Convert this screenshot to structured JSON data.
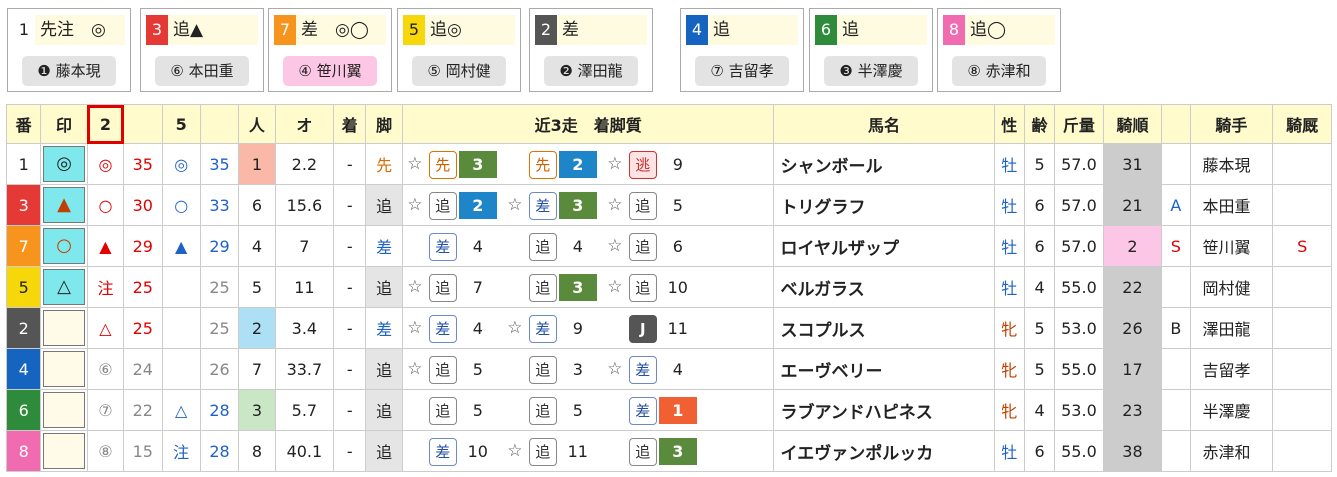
{
  "cards": [
    {
      "num": "1",
      "mark": "先注　◎",
      "jockey": "❶ 藤本現",
      "cls": "c-wk1",
      "pink": false
    },
    {
      "num": "3",
      "mark": "追▲",
      "jockey": "⑥ 本田重",
      "cls": "c-wk3",
      "pink": false
    },
    {
      "num": "7",
      "mark": "差　◎◯",
      "jockey": "④ 笹川翼",
      "cls": "c-wk7",
      "pink": true
    },
    {
      "num": "5",
      "mark": "追◎",
      "jockey": "⑤ 岡村健",
      "cls": "c-wk5",
      "pink": false
    },
    {
      "num": "2",
      "mark": "差",
      "jockey": "❷ 澤田龍",
      "cls": "c-wk2",
      "pink": false
    },
    {
      "num": "4",
      "mark": "追",
      "jockey": "⑦ 吉留孝",
      "cls": "c-wk4",
      "pink": false
    },
    {
      "num": "6",
      "mark": "追",
      "jockey": "❸ 半澤慶",
      "cls": "c-wk6",
      "pink": false
    },
    {
      "num": "8",
      "mark": "追◯",
      "jockey": "⑧ 赤津和",
      "cls": "c-wk8",
      "pink": false
    }
  ],
  "headers": {
    "ban": "番",
    "shirushi": "印",
    "col2": "2",
    "col5": "5",
    "ninki": "人",
    "odds": "オ",
    "chaku": "着",
    "ashi": "脚",
    "recent": "近3走　着脚質",
    "name": "馬名",
    "sex": "性",
    "age": "齢",
    "weight": "斤量",
    "kijun": "騎順",
    "jockey": "騎手",
    "kyusha": "騎厩"
  },
  "rows": [
    {
      "ban": "1",
      "wk": "c-wk1",
      "mark": "◎",
      "markCls": "mk-cyan",
      "m2": "◎",
      "m2c": "red",
      "v2": "35",
      "v2c": "red",
      "m5": "◎",
      "m5c": "blue",
      "v5": "35",
      "v5c": "blue",
      "ninki": "1",
      "nbg": "bgpink",
      "odds": "2.2",
      "chaku": "-",
      "ashi": "先",
      "ashiC": "orange",
      "ashiBg": "",
      "races": [
        {
          "st": "☆",
          "pos": "先",
          "pc": "p-lead",
          "fin": "3",
          "fc": "f-g"
        },
        {
          "st": "",
          "pos": "先",
          "pc": "p-lead",
          "fin": "2",
          "fc": "f-b"
        },
        {
          "st": "☆",
          "pos": "逃",
          "pc": "p-esc",
          "fin": "9",
          "fc": "f-n"
        }
      ],
      "name": "シャンボール",
      "sex": "牡",
      "sexC": "sexm",
      "age": "5",
      "weight": "57.0",
      "kijun": "31",
      "kbg": "kijun",
      "s1": "",
      "jockey": "藤本現",
      "s2": ""
    },
    {
      "ban": "3",
      "wk": "c-wk3",
      "mark": "▲",
      "markCls": "mk-cyan",
      "markC": "brown",
      "m2": "○",
      "m2c": "red",
      "v2": "30",
      "v2c": "red",
      "m5": "○",
      "m5c": "blue",
      "v5": "33",
      "v5c": "blue",
      "ninki": "6",
      "nbg": "",
      "odds": "15.6",
      "chaku": "-",
      "ashi": "追",
      "ashiC": "",
      "ashiBg": "bggrey",
      "races": [
        {
          "st": "☆",
          "pos": "追",
          "pc": "p-oi",
          "fin": "2",
          "fc": "f-b"
        },
        {
          "st": "☆",
          "pos": "差",
          "pc": "p-sashi",
          "fin": "3",
          "fc": "f-g"
        },
        {
          "st": "☆",
          "pos": "追",
          "pc": "p-oi",
          "fin": "5",
          "fc": "f-n"
        }
      ],
      "name": "トリグラフ",
      "sex": "牡",
      "sexC": "sexm",
      "age": "6",
      "weight": "57.0",
      "kijun": "21",
      "kbg": "kijun",
      "s1": "A",
      "s1c": "blue",
      "jockey": "本田重",
      "s2": ""
    },
    {
      "ban": "7",
      "wk": "c-wk7",
      "mark": "○",
      "markCls": "mk-cyan",
      "markC": "brown",
      "m2": "▲",
      "m2c": "red",
      "v2": "29",
      "v2c": "red",
      "m5": "▲",
      "m5c": "blue",
      "v5": "29",
      "v5c": "blue",
      "ninki": "4",
      "nbg": "",
      "odds": "7",
      "chaku": "-",
      "ashi": "差",
      "ashiC": "blue",
      "ashiBg": "",
      "races": [
        {
          "st": "",
          "pos": "差",
          "pc": "p-sashi",
          "fin": "4",
          "fc": "f-n"
        },
        {
          "st": "",
          "pos": "追",
          "pc": "p-oi",
          "fin": "4",
          "fc": "f-n"
        },
        {
          "st": "☆",
          "pos": "追",
          "pc": "p-oi",
          "fin": "6",
          "fc": "f-n"
        }
      ],
      "name": "ロイヤルザップ",
      "sex": "牡",
      "sexC": "sexm",
      "age": "6",
      "weight": "57.0",
      "kijun": "2",
      "kbg": "bgpink2",
      "s1": "S",
      "s1c": "red",
      "jockey": "笹川翼",
      "s2": "S"
    },
    {
      "ban": "5",
      "wk": "c-wk5",
      "mark": "△",
      "markCls": "mk-cyan",
      "m2": "注",
      "m2c": "red",
      "v2": "25",
      "v2c": "red",
      "m5": "",
      "m5c": "",
      "v5": "25",
      "v5c": "grey",
      "ninki": "5",
      "nbg": "",
      "odds": "11",
      "chaku": "-",
      "ashi": "追",
      "ashiC": "",
      "ashiBg": "bggrey",
      "races": [
        {
          "st": "☆",
          "pos": "追",
          "pc": "p-oi",
          "fin": "7",
          "fc": "f-n"
        },
        {
          "st": "",
          "pos": "追",
          "pc": "p-oi",
          "fin": "3",
          "fc": "f-g"
        },
        {
          "st": "☆",
          "pos": "追",
          "pc": "p-oi",
          "fin": "10",
          "fc": "f-n"
        }
      ],
      "name": "ベルガラス",
      "sex": "牡",
      "sexC": "sexm",
      "age": "4",
      "weight": "55.0",
      "kijun": "22",
      "kbg": "kijun",
      "s1": "",
      "jockey": "岡村健",
      "s2": ""
    },
    {
      "ban": "2",
      "wk": "c-wk2",
      "mark": "",
      "markCls": "mk-empty",
      "m2": "△",
      "m2c": "red",
      "v2": "25",
      "v2c": "red",
      "m5": "",
      "m5c": "",
      "v5": "25",
      "v5c": "grey",
      "ninki": "2",
      "nbg": "bglightblue",
      "odds": "3.4",
      "chaku": "-",
      "ashi": "差",
      "ashiC": "blue",
      "ashiBg": "",
      "races": [
        {
          "st": "☆",
          "pos": "差",
          "pc": "p-sashi",
          "fin": "4",
          "fc": "f-n"
        },
        {
          "st": "☆",
          "pos": "差",
          "pc": "p-sashi",
          "fin": "9",
          "fc": "f-n"
        },
        {
          "st": "",
          "pos": "J",
          "pc": "p-j",
          "fin": "11",
          "fc": "f-n"
        }
      ],
      "name": "スコプルス",
      "sex": "牝",
      "sexC": "sexf",
      "age": "5",
      "weight": "53.0",
      "kijun": "26",
      "kbg": "kijun",
      "s1": "B",
      "s1c": "",
      "jockey": "澤田龍",
      "s2": ""
    },
    {
      "ban": "4",
      "wk": "c-wk4",
      "mark": "",
      "markCls": "mk-empty",
      "m2": "⑥",
      "m2c": "grey",
      "v2": "24",
      "v2c": "grey",
      "m5": "",
      "m5c": "",
      "v5": "26",
      "v5c": "grey",
      "ninki": "7",
      "nbg": "",
      "odds": "33.7",
      "chaku": "-",
      "ashi": "追",
      "ashiC": "",
      "ashiBg": "bggrey",
      "races": [
        {
          "st": "☆",
          "pos": "追",
          "pc": "p-oi",
          "fin": "5",
          "fc": "f-n"
        },
        {
          "st": "",
          "pos": "追",
          "pc": "p-oi",
          "fin": "3",
          "fc": "f-n"
        },
        {
          "st": "☆",
          "pos": "差",
          "pc": "p-sashi",
          "fin": "4",
          "fc": "f-n"
        }
      ],
      "name": "エーヴベリー",
      "sex": "牝",
      "sexC": "sexf",
      "age": "5",
      "weight": "55.0",
      "kijun": "17",
      "kbg": "kijun",
      "s1": "",
      "jockey": "吉留孝",
      "s2": ""
    },
    {
      "ban": "6",
      "wk": "c-wk6",
      "mark": "",
      "markCls": "mk-empty",
      "m2": "⑦",
      "m2c": "grey",
      "v2": "22",
      "v2c": "grey",
      "m5": "△",
      "m5c": "blue",
      "v5": "28",
      "v5c": "blue",
      "ninki": "3",
      "nbg": "bglightgreen",
      "odds": "5.7",
      "chaku": "-",
      "ashi": "追",
      "ashiC": "",
      "ashiBg": "bggrey",
      "races": [
        {
          "st": "",
          "pos": "追",
          "pc": "p-oi",
          "fin": "5",
          "fc": "f-n"
        },
        {
          "st": "",
          "pos": "追",
          "pc": "p-oi",
          "fin": "5",
          "fc": "f-n"
        },
        {
          "st": "",
          "pos": "差",
          "pc": "p-sashi",
          "fin": "1",
          "fc": "f-o"
        }
      ],
      "name": "ラブアンドハピネス",
      "sex": "牝",
      "sexC": "sexf",
      "age": "4",
      "weight": "53.0",
      "kijun": "23",
      "kbg": "kijun",
      "s1": "",
      "jockey": "半澤慶",
      "s2": ""
    },
    {
      "ban": "8",
      "wk": "c-wk8",
      "mark": "",
      "markCls": "mk-empty",
      "m2": "⑧",
      "m2c": "grey",
      "v2": "15",
      "v2c": "grey",
      "m5": "注",
      "m5c": "blue",
      "v5": "28",
      "v5c": "blue",
      "ninki": "8",
      "nbg": "",
      "odds": "40.1",
      "chaku": "-",
      "ashi": "追",
      "ashiC": "",
      "ashiBg": "bggrey",
      "races": [
        {
          "st": "",
          "pos": "差",
          "pc": "p-sashi",
          "fin": "10",
          "fc": "f-n"
        },
        {
          "st": "☆",
          "pos": "追",
          "pc": "p-oi",
          "fin": "11",
          "fc": "f-n"
        },
        {
          "st": "",
          "pos": "追",
          "pc": "p-oi",
          "fin": "3",
          "fc": "f-g"
        }
      ],
      "name": "イエヴァンポルッカ",
      "sex": "牡",
      "sexC": "sexm",
      "age": "6",
      "weight": "55.0",
      "kijun": "38",
      "kbg": "kijun",
      "s1": "",
      "jockey": "赤津和",
      "s2": ""
    }
  ]
}
